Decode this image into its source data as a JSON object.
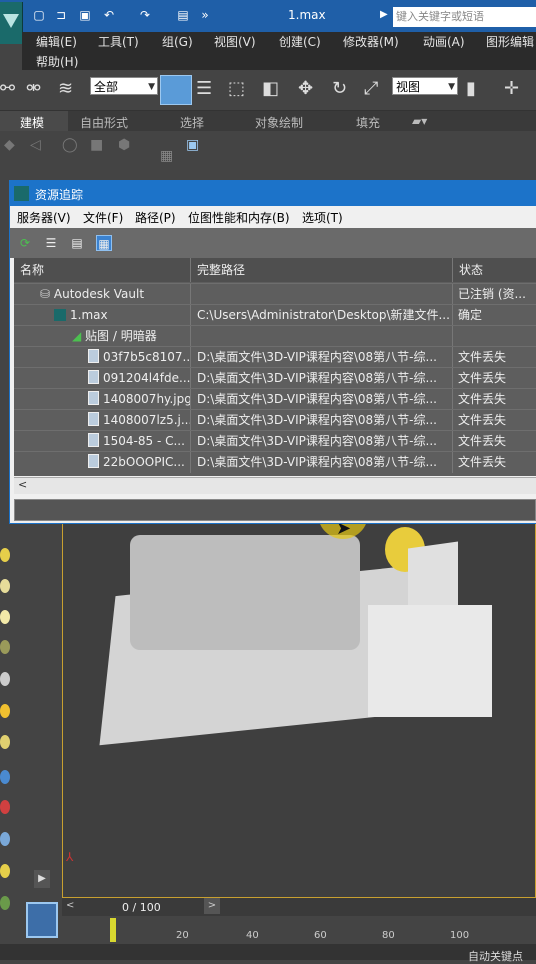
{
  "window": {
    "file_title": "1.max",
    "search_placeholder": "键入关键字或短语",
    "menu": [
      "编辑(E)",
      "工具(T)",
      "组(G)",
      "视图(V)",
      "创建(C)",
      "修改器(M)",
      "动画(A)",
      "图形编辑",
      "帮助(H)"
    ]
  },
  "toolbar": {
    "selection_filter": "全部",
    "ref_coord": "视图"
  },
  "ribbon": {
    "tabs": [
      "建模",
      "自由形式",
      "选择",
      "对象绘制",
      "填充"
    ]
  },
  "dialog": {
    "title": "资源追踪",
    "menu": [
      "服务器(V)",
      "文件(F)",
      "路径(P)",
      "位图性能和内存(B)",
      "选项(T)"
    ],
    "columns": [
      "名称",
      "完整路径",
      "状态"
    ],
    "rows": [
      {
        "name": "Autodesk Vault",
        "path": "",
        "status": "已注销 (资..."
      },
      {
        "name": "1.max",
        "path": "C:\\Users\\Administrator\\Desktop\\新建文件...",
        "status": "确定"
      },
      {
        "name": "贴图 / 明暗器",
        "path": "",
        "status": ""
      },
      {
        "name": "03f7b5c8107...",
        "path": "D:\\桌面文件\\3D-VIP课程内容\\08第八节-综...",
        "status": "文件丢失"
      },
      {
        "name": "091204l4fde...",
        "path": "D:\\桌面文件\\3D-VIP课程内容\\08第八节-综...",
        "status": "文件丢失"
      },
      {
        "name": "1408007hy.jpg",
        "path": "D:\\桌面文件\\3D-VIP课程内容\\08第八节-综...",
        "status": "文件丢失"
      },
      {
        "name": "1408007lz5.j...",
        "path": "D:\\桌面文件\\3D-VIP课程内容\\08第八节-综...",
        "status": "文件丢失"
      },
      {
        "name": "1504-85 - C...",
        "path": "D:\\桌面文件\\3D-VIP课程内容\\08第八节-综...",
        "status": "文件丢失"
      },
      {
        "name": "22bOOOPIC...",
        "path": "D:\\桌面文件\\3D-VIP课程内容\\08第八节-综...",
        "status": "文件丢失"
      }
    ]
  },
  "timeline": {
    "frame_text": "0 / 100",
    "ticks": [
      "20",
      "40",
      "60",
      "80",
      "100"
    ],
    "autokey_label": "自动关键点"
  },
  "colors": {
    "titlebar": "#1f5fa8",
    "dialog_title": "#1c73c9",
    "viewport_border": "#c8a030"
  }
}
